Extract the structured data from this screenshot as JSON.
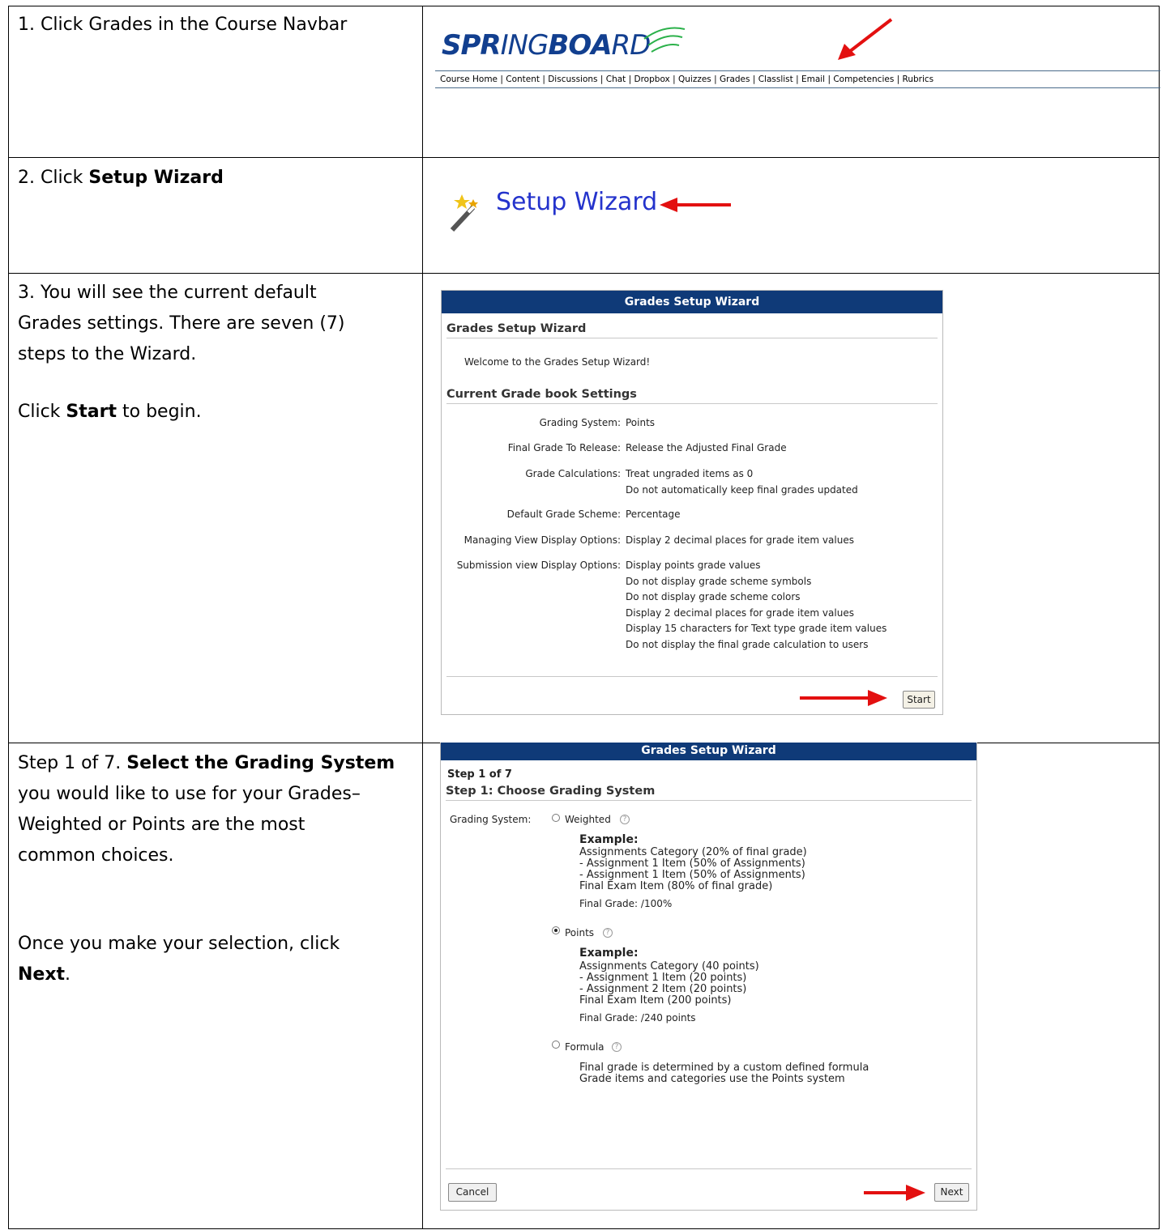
{
  "steps": {
    "s1": "1. Click Grades in the Course Navbar",
    "s2_pre": "2. Click ",
    "s2_bold": "Setup Wizard",
    "s3_line1": "3. You will see the current default",
    "s3_line2": "Grades settings. There are seven (7)",
    "s3_line3": "steps to the Wizard.",
    "s3_click_pre": "Click ",
    "s3_click_bold": "Start",
    "s3_click_post": " to begin.",
    "s4_pre": "Step 1 of 7.  ",
    "s4_bold": "Select the Grading System",
    "s4_line2": "you would like to use for your Grades–",
    "s4_line3": "Weighted or Points are the most",
    "s4_line4": "common choices.",
    "s4_next_line1": "Once you make your selection, click",
    "s4_next_bold": "Next",
    "s4_next_post": "."
  },
  "springboard": {
    "logo_a": "SPR",
    "logo_b": "ING",
    "logo_c": "BOA",
    "logo_d": "RD",
    "nav": [
      "Course Home",
      "Content",
      "Discussions",
      "Chat",
      "Dropbox",
      "Quizzes",
      "Grades",
      "Classlist",
      "Email",
      "Competencies",
      "Rubrics"
    ]
  },
  "setup_wizard_link": "Setup Wizard",
  "wizard1": {
    "title": "Grades Setup Wizard",
    "heading": "Grades Setup Wizard",
    "welcome": "Welcome to the Grades Setup Wizard!",
    "current_heading": "Current Grade book Settings",
    "settings": [
      {
        "label": "Grading System:",
        "values": [
          "Points"
        ]
      },
      {
        "label": "Final Grade To Release:",
        "values": [
          "Release the Adjusted Final Grade"
        ]
      },
      {
        "label": "Grade Calculations:",
        "values": [
          "Treat ungraded items as 0",
          "Do not automatically keep final grades updated"
        ]
      },
      {
        "label": "Default Grade Scheme:",
        "values": [
          "Percentage"
        ]
      },
      {
        "label": "Managing View Display Options:",
        "values": [
          "Display 2 decimal places for grade item values"
        ]
      },
      {
        "label": "Submission view Display Options:",
        "values": [
          "Display points grade values",
          "Do not display grade scheme symbols",
          "Do not display grade scheme colors",
          "Display 2 decimal places for grade item values",
          "Display 15 characters for Text type grade item values",
          "Do not display the final grade calculation to users"
        ]
      }
    ],
    "start": "Start"
  },
  "wizard2": {
    "title": "Grades Setup Wizard",
    "step": "Step 1 of 7",
    "heading": "Step 1: Choose Grading System",
    "grading_label": "Grading System:",
    "weighted": "Weighted",
    "example": "Example:",
    "weighted_example": "Assignments Category (20% of final grade)\n- Assignment 1 Item (50% of Assignments)\n- Assignment 1 Item (50% of Assignments)\nFinal Exam Item (80% of final grade)",
    "weighted_final": "Final Grade: /100%",
    "points": "Points",
    "points_example": "Assignments Category (40 points)\n- Assignment 1 Item (20 points)\n- Assignment 2 Item (20 points)\nFinal Exam Item (200 points)",
    "points_final": "Final Grade: /240 points",
    "formula": "Formula",
    "formula_desc": "Final grade is determined by a custom defined formula\nGrade items and categories use the Points system",
    "cancel": "Cancel",
    "next": "Next"
  }
}
